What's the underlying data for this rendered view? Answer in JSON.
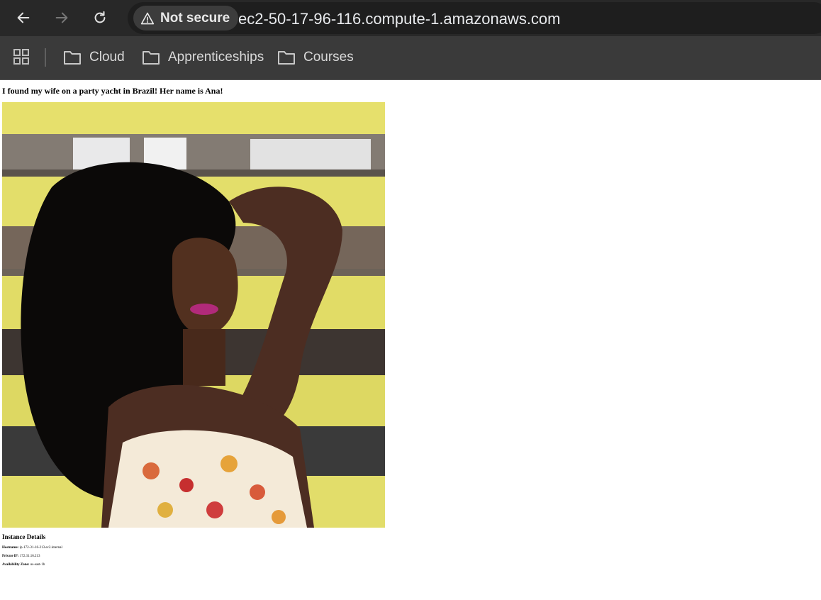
{
  "browser": {
    "security_label": "Not secure",
    "url": "ec2-50-17-96-116.compute-1.amazonaws.com",
    "icons": {
      "back": "arrow-left-icon",
      "forward": "arrow-right-icon",
      "reload": "reload-icon",
      "warning": "warning-triangle-icon",
      "apps": "apps-grid-icon",
      "folder": "folder-icon"
    }
  },
  "bookmarks": [
    {
      "label": "Cloud"
    },
    {
      "label": "Apprenticeships"
    },
    {
      "label": "Courses"
    }
  ],
  "page": {
    "heading": "I found my wife on a party yacht in Brazil! Her name is Ana!",
    "image_alt_subject": "portrait-photo",
    "instance": {
      "title": "Instance Details",
      "hostname_label": "Hostname:",
      "hostname": "ip-172-31-16-213.ec2.internal",
      "private_ip_label": "Private IP:",
      "private_ip": "172.31.16.213",
      "az_label": "Availability Zone:",
      "az": "us-east-1b"
    }
  },
  "colors": {
    "toolbar": "#282828",
    "bookmark_bar": "#3a3a3a",
    "chip": "#3c3c3c",
    "wall_yellow": "#e8e26a"
  }
}
